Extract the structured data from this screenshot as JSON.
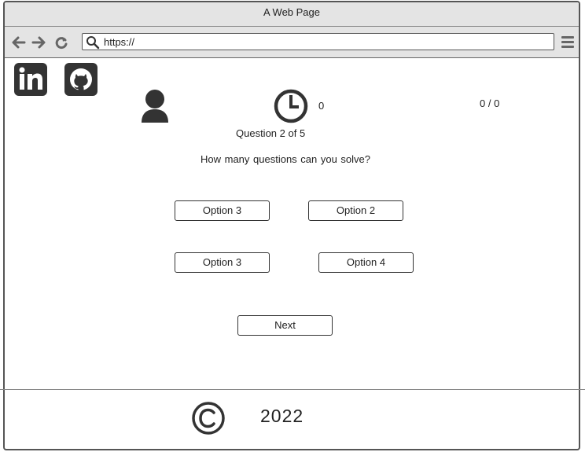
{
  "browser": {
    "title": "A Web Page",
    "url": "https://",
    "icons": [
      "back-icon",
      "forward-icon",
      "reload-icon",
      "search-icon",
      "menu-icon"
    ]
  },
  "social": {
    "linkedin_text": "in",
    "icons": [
      "linkedin-icon",
      "github-icon"
    ]
  },
  "quiz": {
    "timer_value": "0",
    "score": "0 / 0",
    "question_count": "Question 2 of 5",
    "question_text": "How many questions  can you solve?",
    "options": [
      "Option 3",
      "Option 2",
      "Option 3",
      "Option 4"
    ],
    "next_label": "Next"
  },
  "footer": {
    "year": "2022",
    "icon": "copyright-icon"
  }
}
